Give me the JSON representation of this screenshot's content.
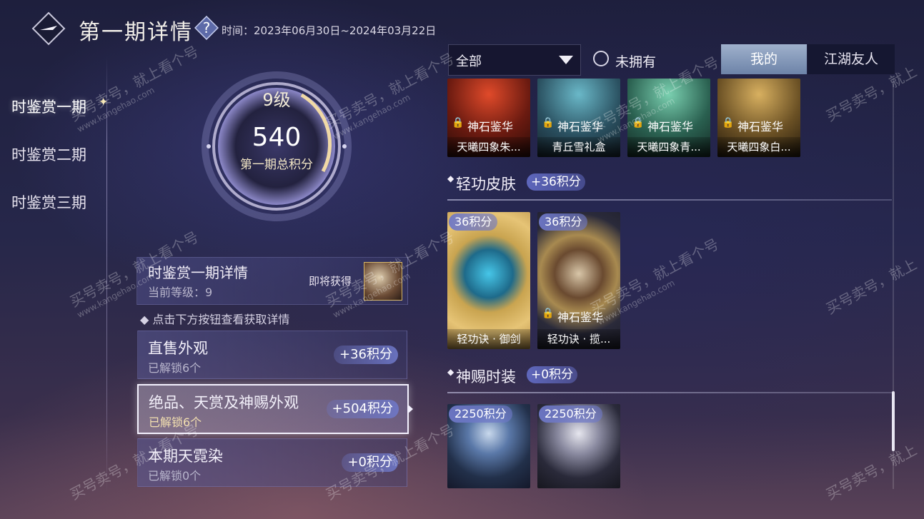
{
  "header": {
    "title": "第一期详情",
    "time_text": "时间：2023年06月30日~2024年03月22日"
  },
  "tabs": [
    "时鉴赏一期",
    "时鉴赏二期",
    "时鉴赏三期"
  ],
  "summary": {
    "level": "9级",
    "score": "540",
    "score_label": "第一期总积分"
  },
  "detail": {
    "title": "时鉴赏一期详情",
    "current_level": "当前等级：9",
    "get_label": "即将获得",
    "hint": "点击下方按钮查看获取详情"
  },
  "categories": [
    {
      "title": "直售外观",
      "sub": "已解锁6个",
      "points": "+36积分"
    },
    {
      "title": "绝品、天赏及神赐外观",
      "sub": "已解锁6个",
      "points": "+504积分"
    },
    {
      "title": "本期天霓染",
      "sub": "已解锁0个",
      "points": "+0积分"
    }
  ],
  "filters": {
    "dropdown": "全部",
    "radio_label": "未拥有",
    "seg_mine": "我的",
    "seg_friends": "江湖友人"
  },
  "top_cards": [
    {
      "tag": "神石鉴华",
      "name": "天曦四象朱..."
    },
    {
      "tag": "神石鉴华",
      "name": "青丘雪礼盒"
    },
    {
      "tag": "神石鉴华",
      "name": "天曦四象青..."
    },
    {
      "tag": "神石鉴华",
      "name": "天曦四象白..."
    }
  ],
  "sections": [
    {
      "title": "轻功皮肤",
      "points": "+36积分",
      "cards": [
        {
          "cost": "36积分",
          "tag": "",
          "name": "轻功诀 · 御剑"
        },
        {
          "cost": "36积分",
          "tag": "神石鉴华",
          "name": "轻功诀 · 揽..."
        }
      ]
    },
    {
      "title": "神赐时装",
      "points": "+0积分",
      "cards": [
        {
          "cost": "2250积分"
        },
        {
          "cost": "2250积分"
        }
      ]
    }
  ],
  "watermark": {
    "line1": "买号卖号，就上看个号",
    "line2": "www.kangehao.com",
    "badge": "看个号"
  }
}
